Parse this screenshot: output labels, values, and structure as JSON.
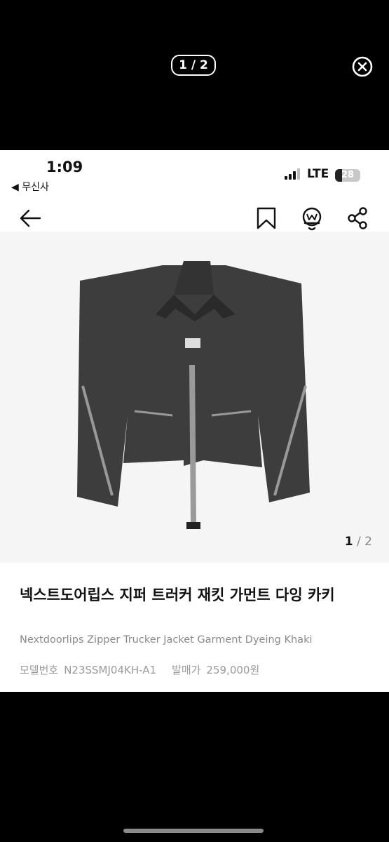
{
  "viewer": {
    "counter": "1 / 2",
    "close_icon": "close-circle-icon"
  },
  "status_bar": {
    "time": "1:09",
    "back_app": "◀ 무신사",
    "network": "LTE",
    "battery": "28",
    "battery_level": 0.28
  },
  "nav": {
    "icons": [
      "back-arrow-icon",
      "bookmark-icon",
      "wear-bell-icon",
      "share-icon"
    ]
  },
  "image_counter": {
    "current": "1",
    "separator": " / ",
    "total": "2"
  },
  "product": {
    "title": "넥스트도어립스 지퍼 트러커 재킷 가먼트 다잉 카키",
    "english_name": "Nextdoorlips Zipper Trucker Jacket Garment Dyeing Khaki",
    "model_label": "모델번호",
    "model_number": "N23SSMJ04KH-A1",
    "release_price_label": "발매가",
    "release_price": "259,000원"
  }
}
